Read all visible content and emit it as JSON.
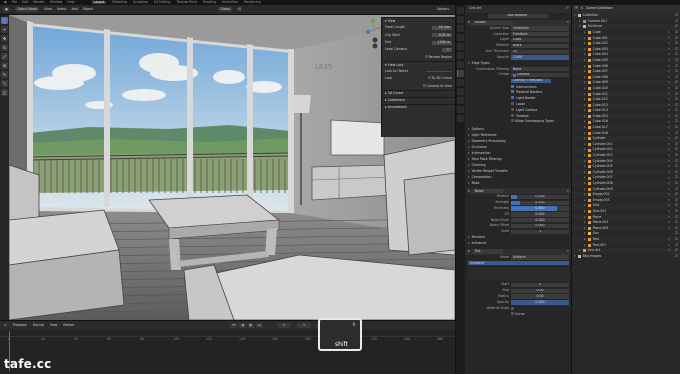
{
  "menubar": {
    "menus": [
      "File",
      "Edit",
      "Render",
      "Window",
      "Help"
    ],
    "tabs": [
      "Layout",
      "Modeling",
      "Sculpting",
      "UV Editing",
      "Texture Paint",
      "Shading",
      "Animation",
      "Rendering"
    ],
    "active_tab": "Layout"
  },
  "viewport_header": {
    "mode": "Object Mode",
    "menus": [
      "View",
      "Select",
      "Add",
      "Object"
    ],
    "orientation": "Global",
    "options": "Options"
  },
  "n_panel": {
    "title": "View",
    "focal_length_label": "Focal Length",
    "focal_length": "50 mm",
    "clip_start_label": "Clip Start",
    "clip_start": "0.01 m",
    "clip_end_label": "End",
    "clip_end": "1000 m",
    "local_camera_label": "Local Camera",
    "render_region_label": "Render Region",
    "view_lock_label": "View Lock",
    "lock_to_object_label": "Lock to Object",
    "lock_label": "Lock",
    "lock_to_3d_cursor": "To 3D Cursor",
    "camera_to_view": "Camera to View",
    "sections": [
      "3D Cursor",
      "Collections",
      "Annotations"
    ]
  },
  "viewport": {
    "wall_sign": "L835"
  },
  "timeline": {
    "menus": [
      "Playback",
      "Keying",
      "View",
      "Marker"
    ],
    "ticks": [
      "0",
      "20",
      "40",
      "60",
      "80",
      "100",
      "120",
      "140",
      "160",
      "180",
      "200",
      "220",
      "240",
      "260"
    ],
    "current_frame": "1",
    "start": "1",
    "end": "250"
  },
  "shift_key": "shift",
  "watermark": "tafe.cc",
  "properties": {
    "tab_label": "Line Art",
    "subtitle": "Add Modifier",
    "modifier_name": "Lineart",
    "source_type_label": "Source Type",
    "source_type": "Collection",
    "collection_label": "Collection",
    "collection": "Furniture",
    "layer_label": "Layer",
    "layer": "Lines",
    "material_label": "Material",
    "material": "Black",
    "line_thickness_label": "Line Thickness",
    "line_thickness": "25",
    "opacity_label": "Opacity",
    "opacity": "1.000",
    "opacity_value": 1.0,
    "edge_types_label": "Edge Types",
    "illumination_filtering_label": "Illumination Filtering",
    "illumination_filtering": "None",
    "edge_type_create_label": "Create",
    "edge_type_contour": "Contour",
    "edge_type_contour_threshold": "Contour Threshold",
    "edge_type_list": [
      "Intersections",
      "Material Borders",
      "Light Border",
      "Loose",
      "Light Contour",
      "Shadow"
    ],
    "allow_overlapping_types": "Allow Overlapping Types",
    "options_label": "Options",
    "collapsed_sections": [
      "Light Reference",
      "Geometry Processing",
      "Occlusion",
      "Intersection",
      "Face Mark Filtering",
      "Chaining",
      "Vertex Weight Transfer",
      "Composition",
      "Bake"
    ],
    "noise_modifier": "Noise",
    "noise_rows": [
      {
        "label": "Position",
        "value": "0.100",
        "fill": 0.1
      },
      {
        "label": "Strength",
        "value": "0.150",
        "fill": 0.15
      },
      {
        "label": "Thickness",
        "value": "0.800",
        "fill": 0.8
      },
      {
        "label": "UV",
        "value": "0.000",
        "fill": 0.0
      },
      {
        "label": "Noise Scale",
        "value": "0.000",
        "fill": 0.0
      },
      {
        "label": "Noise Offset",
        "value": "0.000",
        "fill": 0.0
      },
      {
        "label": "Seed",
        "value": "1",
        "fill": 0.0
      }
    ],
    "random_label": "Random",
    "influence_label": "Influence",
    "tint_modifier": "Tint",
    "tint_mode_label": "Mode",
    "tint_mode": "Uniform",
    "gradient_label": "Gradient",
    "tint_rows": [
      {
        "label": "Start",
        "value": "0"
      },
      {
        "label": "Size",
        "value": "0.00"
      },
      {
        "label": "Radius",
        "value": "0.00"
      },
      {
        "label": "Opacity",
        "value": "0.000"
      }
    ],
    "material_scale_label": "Material Scale",
    "curve_label": "Curve"
  },
  "outliner": {
    "title": "Scene Collection",
    "items": [
      {
        "name": "Collection",
        "kind": "coll",
        "indent": 0
      },
      {
        "name": "Camera.001",
        "kind": "cam",
        "indent": 1
      },
      {
        "name": "Furniture",
        "kind": "coll",
        "indent": 1
      },
      {
        "name": "Cube",
        "kind": "obj",
        "indent": 2
      },
      {
        "name": "Cube.001",
        "kind": "obj",
        "indent": 2
      },
      {
        "name": "Cube.002",
        "kind": "obj",
        "indent": 2
      },
      {
        "name": "Cube.003",
        "kind": "obj",
        "indent": 2
      },
      {
        "name": "Cube.004",
        "kind": "obj",
        "indent": 2
      },
      {
        "name": "Cube.005",
        "kind": "obj",
        "indent": 2
      },
      {
        "name": "Cube.006",
        "kind": "obj",
        "indent": 2
      },
      {
        "name": "Cube.007",
        "kind": "obj",
        "indent": 2
      },
      {
        "name": "Cube.008",
        "kind": "obj",
        "indent": 2
      },
      {
        "name": "Cube.009",
        "kind": "obj",
        "indent": 2
      },
      {
        "name": "Cube.010",
        "kind": "obj",
        "indent": 2
      },
      {
        "name": "Cube.011",
        "kind": "obj",
        "indent": 2
      },
      {
        "name": "Cube.012",
        "kind": "obj",
        "indent": 2
      },
      {
        "name": "Cube.013",
        "kind": "obj",
        "indent": 2
      },
      {
        "name": "Cube.014",
        "kind": "obj",
        "indent": 2
      },
      {
        "name": "Cube.015",
        "kind": "obj",
        "indent": 2
      },
      {
        "name": "Cube.016",
        "kind": "obj",
        "indent": 2
      },
      {
        "name": "Cube.017",
        "kind": "obj",
        "indent": 2
      },
      {
        "name": "Cube.018",
        "kind": "obj",
        "indent": 2
      },
      {
        "name": "Cylinder",
        "kind": "obj",
        "indent": 2
      },
      {
        "name": "Cylinder.001",
        "kind": "obj",
        "indent": 2
      },
      {
        "name": "Cylinder.002",
        "kind": "obj",
        "indent": 2
      },
      {
        "name": "Cylinder.003",
        "kind": "obj",
        "indent": 2
      },
      {
        "name": "Cylinder.004",
        "kind": "obj",
        "indent": 2
      },
      {
        "name": "Cylinder.005",
        "kind": "obj",
        "indent": 2
      },
      {
        "name": "Cylinder.006",
        "kind": "obj",
        "indent": 2
      },
      {
        "name": "Cylinder.007",
        "kind": "obj",
        "indent": 2
      },
      {
        "name": "Cylinder.008",
        "kind": "obj",
        "indent": 2
      },
      {
        "name": "Cylinder.009",
        "kind": "obj",
        "indent": 2
      },
      {
        "name": "Empty.002",
        "kind": "obj",
        "indent": 2
      },
      {
        "name": "Empty.003",
        "kind": "obj",
        "indent": 2
      },
      {
        "name": "Grid",
        "kind": "obj",
        "indent": 2
      },
      {
        "name": "Grid.001",
        "kind": "obj",
        "indent": 2
      },
      {
        "name": "Plane",
        "kind": "obj",
        "indent": 2
      },
      {
        "name": "Plane.001",
        "kind": "obj",
        "indent": 2
      },
      {
        "name": "Plane.002",
        "kind": "obj",
        "indent": 2
      },
      {
        "name": "Sun",
        "kind": "lt",
        "indent": 2
      },
      {
        "name": "Text",
        "kind": "obj",
        "indent": 2
      },
      {
        "name": "Text.001",
        "kind": "obj",
        "indent": 2
      },
      {
        "name": "Line Art",
        "kind": "obj",
        "indent": 1
      },
      {
        "name": "Bkg Images",
        "kind": "coll",
        "indent": 0
      }
    ]
  },
  "colors": {
    "accent": "#4772b3",
    "object": "#e79b3b",
    "modifier": "#7ab86b"
  }
}
